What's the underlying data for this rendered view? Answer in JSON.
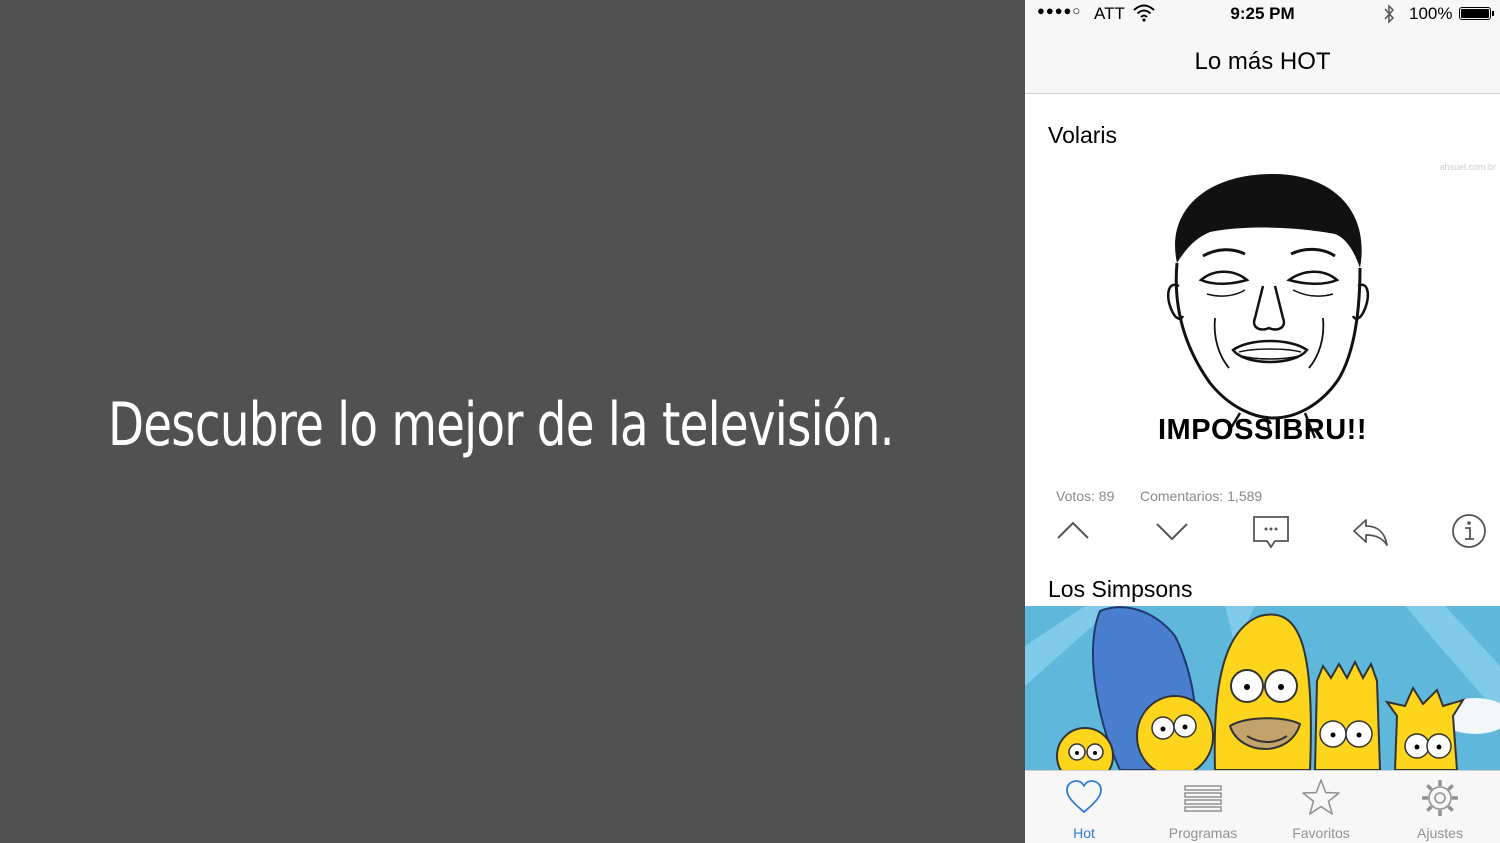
{
  "tagline": "Descubre lo mejor de la televisión.",
  "status_bar": {
    "signal": "●●●●○",
    "carrier": "ATT",
    "time": "9:25 PM",
    "battery": "100%"
  },
  "nav": {
    "title": "Lo más HOT"
  },
  "posts": [
    {
      "title": "Volaris",
      "image_caption": "IMPOSSIBRU!!",
      "watermark": "ahsuel.com.br",
      "votes": "Votos: 89",
      "comments": "Comentarios: 1,589"
    },
    {
      "title": "Los Simpsons"
    }
  ],
  "actions": [
    "upvote-icon",
    "downvote-icon",
    "comment-icon",
    "share-icon",
    "info-icon"
  ],
  "tabs": [
    {
      "label": "Hot",
      "icon": "heart-icon",
      "active": true
    },
    {
      "label": "Programas",
      "icon": "list-icon",
      "active": false
    },
    {
      "label": "Favoritos",
      "icon": "star-icon",
      "active": false
    },
    {
      "label": "Ajustes",
      "icon": "gear-icon",
      "active": false
    }
  ],
  "colors": {
    "background": "#515151",
    "accent": "#2f7bd8",
    "inactive": "#929292",
    "sky": "#5fb8dc",
    "simpson_yellow": "#fcd51c",
    "marge_hair": "#4a7fd0"
  }
}
